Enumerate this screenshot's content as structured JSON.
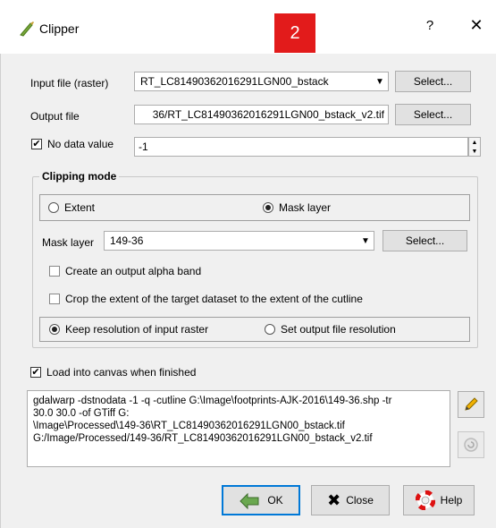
{
  "window": {
    "title": "Clipper",
    "help_glyph": "?",
    "close_glyph": "✕"
  },
  "badge": "2",
  "input_file": {
    "label": "Input file (raster)",
    "value": "RT_LC81490362016291LGN00_bstack",
    "select_label": "Select..."
  },
  "output_file": {
    "label": "Output file",
    "value": "36/RT_LC81490362016291LGN00_bstack_v2.tif",
    "select_label": "Select..."
  },
  "no_data": {
    "label": "No data value",
    "checked": true,
    "value": "-1"
  },
  "clipping_mode": {
    "title": "Clipping mode",
    "extent_label": "Extent",
    "mask_layer_radio_label": "Mask layer",
    "selected": "Mask layer",
    "mask_layer": {
      "label": "Mask layer",
      "value": "149-36",
      "select_label": "Select..."
    },
    "create_alpha_label": "Create an output alpha band",
    "crop_extent_label": "Crop the extent of the target dataset to the extent of the cutline",
    "keep_resolution_label": "Keep resolution of input raster",
    "set_resolution_label": "Set output file resolution",
    "resolution_selected": "Keep resolution of input raster"
  },
  "load_canvas": {
    "label": "Load into canvas when finished",
    "checked": true
  },
  "command": {
    "lines": [
      "gdalwarp -dstnodata -1 -q -cutline G:\\Image\\footprints-AJK-2016\\149-36.shp -tr",
      "30.0 30.0 -of GTiff G:",
      "\\Image\\Processed\\149-36\\RT_LC81490362016291LGN00_bstack.tif",
      "G:/Image/Processed/149-36/RT_LC81490362016291LGN00_bstack_v2.tif"
    ]
  },
  "buttons": {
    "ok": "OK",
    "close": "Close",
    "help": "Help"
  },
  "colors": {
    "badge": "#e21b1b",
    "client_bg": "#f0f0f0",
    "default_border": "#0078d7"
  }
}
